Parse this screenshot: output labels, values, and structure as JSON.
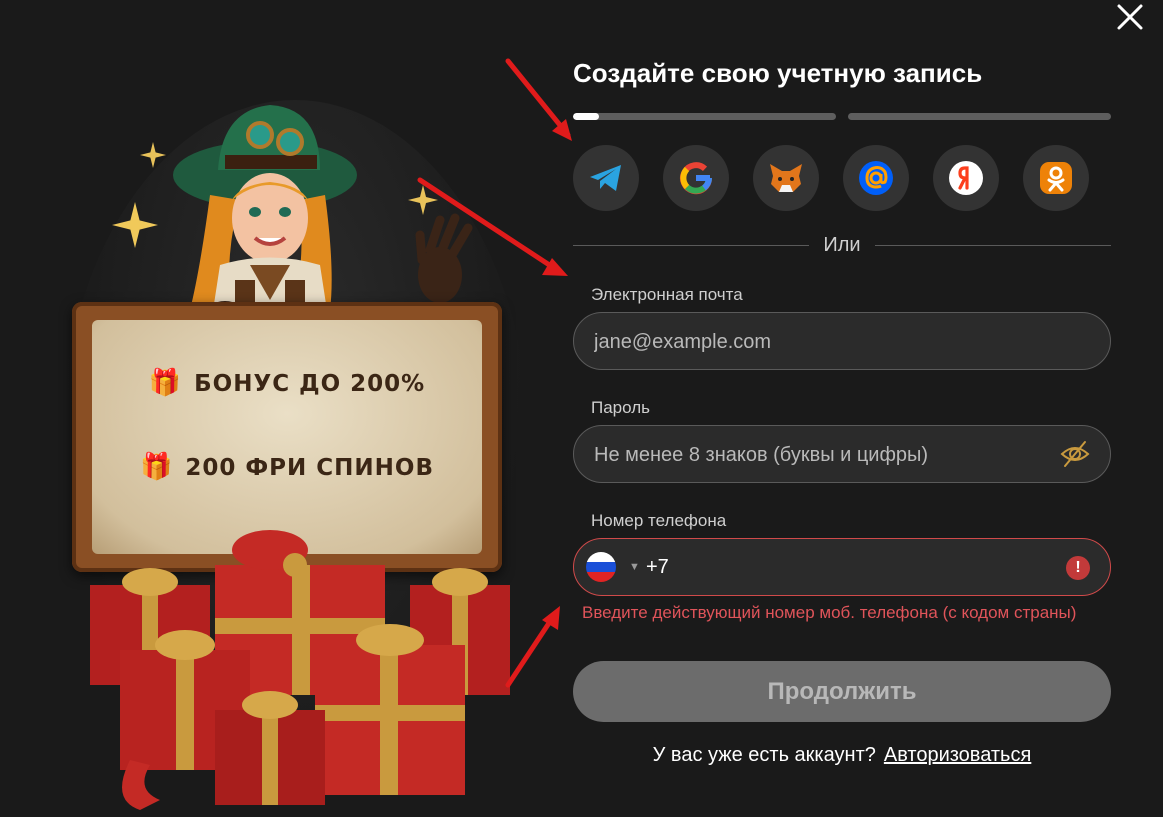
{
  "form": {
    "title": "Создайте свою учетную запись",
    "progress_fraction": 0.1,
    "divider_text": "Или",
    "email": {
      "label": "Электронная почта",
      "placeholder": "jane@example.com",
      "value": ""
    },
    "password": {
      "label": "Пароль",
      "placeholder": "Не менее 8 знаков (буквы и цифры)",
      "value": ""
    },
    "phone": {
      "label": "Номер телефона",
      "country": "RU",
      "prefix": "+7",
      "value": ""
    },
    "error_text": "Введите действующий номер моб. телефона (с кодом страны)",
    "continue_label": "Продолжить",
    "footer_text": "У вас уже есть аккаунт?",
    "login_link": "Авторизоваться"
  },
  "socials": [
    {
      "name": "telegram",
      "icon": "telegram-icon",
      "color": "#2aa3e0"
    },
    {
      "name": "google",
      "icon": "google-icon",
      "color": "#4285f4"
    },
    {
      "name": "metamask",
      "icon": "metamask-icon",
      "color": "#e2761b"
    },
    {
      "name": "mail-ru",
      "icon": "mailru-icon",
      "color": "#005ff9"
    },
    {
      "name": "yandex",
      "icon": "yandex-icon",
      "color": "#fc3f1d"
    },
    {
      "name": "odnoklassniki",
      "icon": "ok-icon",
      "color": "#ee8208"
    }
  ],
  "promo": {
    "line1": "БОНУС ДО 200%",
    "line2": "200 ФРИ СПИНОВ"
  },
  "colors": {
    "background": "#1a1a1a",
    "error": "#e0545a",
    "button_disabled": "#6c6c6c",
    "arrow": "#e01b1b"
  }
}
